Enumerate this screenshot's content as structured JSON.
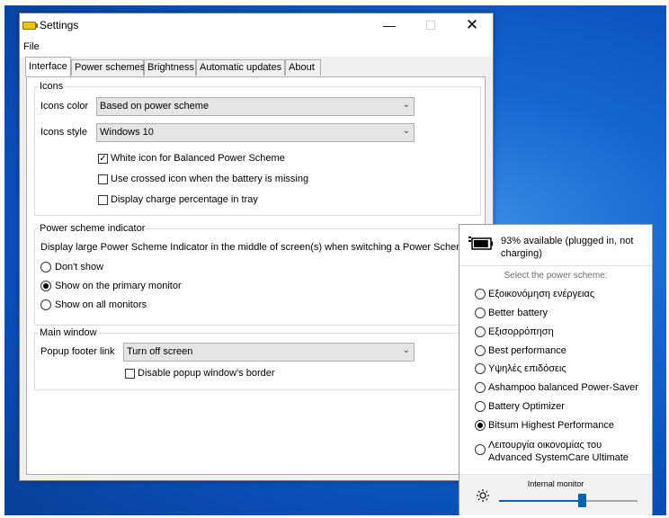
{
  "window": {
    "title": "Settings",
    "controls": {
      "minimize": "—",
      "maximize": "☐",
      "close": "✕"
    }
  },
  "menu": {
    "file": "File"
  },
  "tabs": [
    {
      "label": "Interface",
      "active": true
    },
    {
      "label": "Power schemes",
      "active": false
    },
    {
      "label": "Brightness",
      "active": false
    },
    {
      "label": "Automatic updates",
      "active": false
    },
    {
      "label": "About",
      "active": false
    }
  ],
  "icons_group": {
    "title": "Icons",
    "color_label": "Icons color",
    "color_value": "Based on power scheme",
    "style_label": "Icons style",
    "style_value": "Windows 10",
    "checkboxes": [
      {
        "label": "White icon for Balanced Power Scheme",
        "checked": true
      },
      {
        "label": "Use crossed icon when the battery is missing",
        "checked": false
      },
      {
        "label": "Display charge percentage in tray",
        "checked": false
      }
    ]
  },
  "indicator_group": {
    "title": "Power scheme indicator",
    "description": "Display large Power Scheme Indicator in the middle of screen(s) when switching a Power Scheme",
    "options": [
      {
        "label": "Don't show",
        "selected": false
      },
      {
        "label": "Show on the primary monitor",
        "selected": true
      },
      {
        "label": "Show on all monitors",
        "selected": false
      }
    ]
  },
  "main_window_group": {
    "title": "Main window",
    "footer_label": "Popup footer link",
    "footer_value": "Turn off screen",
    "border_checkbox": {
      "label": "Disable popup window's border",
      "checked": false
    }
  },
  "popup": {
    "battery_text": "93% available (plugged in, not charging)",
    "battery_percent": 93,
    "select_title": "Select the power scheme:",
    "schemes": [
      {
        "label": "Εξοικονόμηση ενέργειας",
        "selected": false
      },
      {
        "label": "Better battery",
        "selected": false
      },
      {
        "label": "Εξισορρόπηση",
        "selected": false
      },
      {
        "label": "Best performance",
        "selected": false
      },
      {
        "label": "Υψηλές επιδόσεις",
        "selected": false
      },
      {
        "label": "Ashampoo balanced Power-Saver",
        "selected": false
      },
      {
        "label": "Battery Optimizer",
        "selected": false
      },
      {
        "label": "Bitsum Highest Performance",
        "selected": true
      },
      {
        "label": "Λειτουργία οικονομίας του",
        "label2": "Advanced SystemCare Ultimate",
        "selected": false
      }
    ],
    "monitor_label": "Internal monitor",
    "brightness_fraction": 0.6,
    "accent_color": "#0063b1"
  }
}
